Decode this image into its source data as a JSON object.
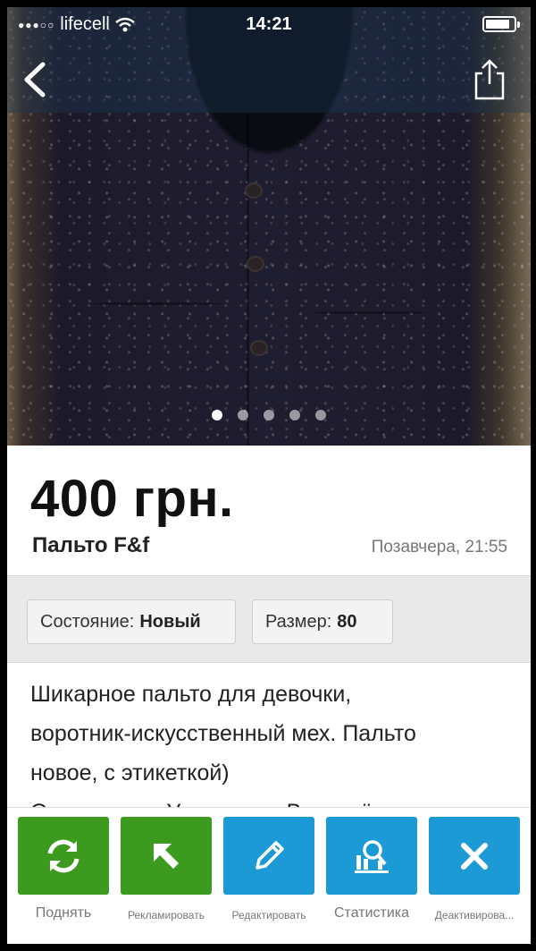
{
  "status_bar": {
    "carrier": "lifecell",
    "time": "14:21"
  },
  "gallery": {
    "image_count": 5,
    "active_index": 0
  },
  "listing": {
    "price": "400 грн.",
    "title": "Пальто F&f",
    "date": "Позавчера, 21:55"
  },
  "params": [
    {
      "label": "Состояние:",
      "value": "Новый"
    },
    {
      "label": "Размер:",
      "value": "80"
    }
  ],
  "description": {
    "line1": "Шикарное пальто для девочки,",
    "line2": "воротник-искусственный мех. Пальто",
    "line3": "новое, с этикеткой)",
    "line4": "Отправка по Украине за Ваш счёт"
  },
  "toolbar": {
    "raise_label": "Поднять",
    "promote_label": "Рекламировать",
    "edit_label": "Редактировать",
    "stats_label": "Статистика",
    "deactivate_label": "Деактивирова..."
  },
  "colors": {
    "green": "#3c9a1f",
    "blue": "#1c9ad6"
  }
}
